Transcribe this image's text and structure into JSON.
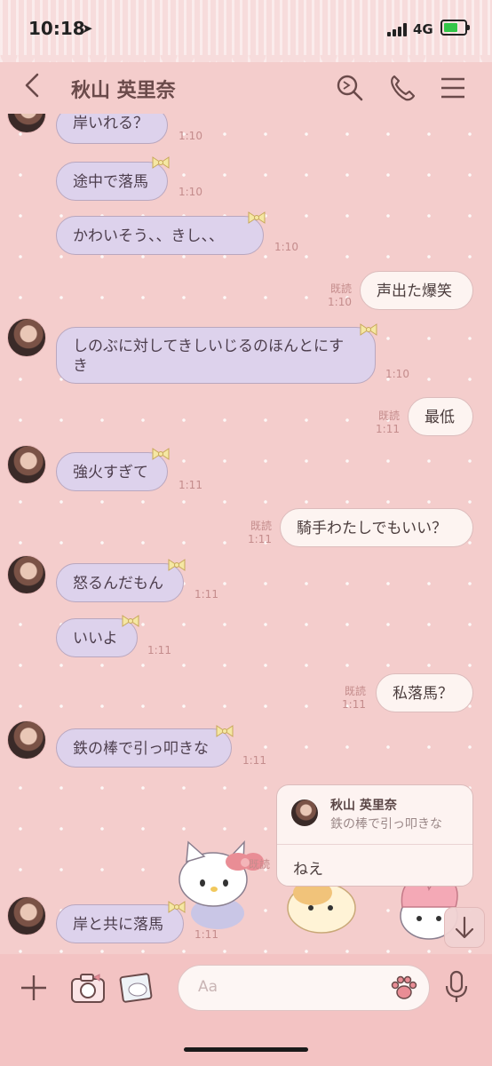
{
  "status": {
    "time": "10:18",
    "network": "4G"
  },
  "header": {
    "title": "秋山 英里奈"
  },
  "messages": {
    "m1": {
      "text": "岸いれる？",
      "time": "1:10"
    },
    "m2": {
      "text": "途中で落馬",
      "time": "1:10"
    },
    "m3": {
      "text": "かわいそう、、きし、、",
      "time": "1:10"
    },
    "m4": {
      "text": "声出た爆笑",
      "read": "既読",
      "time": "1:10"
    },
    "m5": {
      "text": "しのぶに対してきしいじるのほんとにすき",
      "time": "1:10"
    },
    "m6": {
      "text": "最低",
      "read": "既読",
      "time": "1:11"
    },
    "m7": {
      "text": "強火すぎて",
      "time": "1:11"
    },
    "m8": {
      "text": "騎手わたしでもいい？",
      "read": "既読",
      "time": "1:11"
    },
    "m9": {
      "text": "怒るんだもん",
      "time": "1:11"
    },
    "m10": {
      "text": "いいよ",
      "time": "1:11"
    },
    "m11": {
      "text": "私落馬？",
      "read": "既読",
      "time": "1:11"
    },
    "m12": {
      "text": "鉄の棒で引っ叩きな",
      "time": "1:11"
    },
    "m13": {
      "text": "岸と共に落馬",
      "time": "1:11"
    }
  },
  "reply": {
    "name": "秋山 英里奈",
    "quote": "鉄の棒で引っ叩きな",
    "text": "ねえ",
    "hidden_read": "既読"
  },
  "composer": {
    "placeholder": "Aa"
  },
  "colors": {
    "background": "#f4cdcc",
    "incoming_bubble": "#ddd2ec",
    "outgoing_bubble": "#fdf4f1",
    "bottom_bar": "#f3c3c3"
  },
  "icons": [
    "back-icon",
    "search-icon",
    "phone-icon",
    "menu-icon",
    "plus-icon",
    "camera-icon",
    "photo-icon",
    "paw-icon",
    "mic-icon",
    "arrow-down-icon"
  ]
}
